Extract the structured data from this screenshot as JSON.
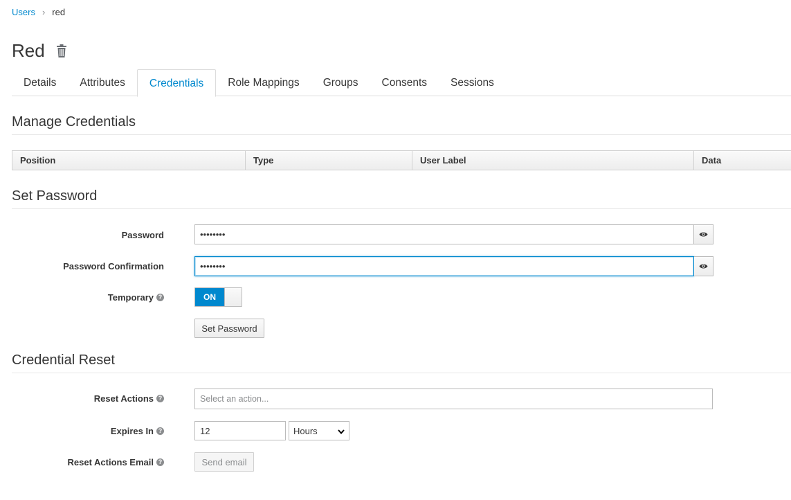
{
  "breadcrumb": {
    "parent": "Users",
    "separator": "›",
    "current": "red"
  },
  "page": {
    "title": "Red"
  },
  "tabs": [
    {
      "label": "Details"
    },
    {
      "label": "Attributes"
    },
    {
      "label": "Credentials",
      "active": true
    },
    {
      "label": "Role Mappings"
    },
    {
      "label": "Groups"
    },
    {
      "label": "Consents"
    },
    {
      "label": "Sessions"
    }
  ],
  "manage": {
    "title": "Manage Credentials",
    "columns": [
      "Position",
      "Type",
      "User Label",
      "Data"
    ]
  },
  "set_password": {
    "title": "Set Password",
    "password_label": "Password",
    "password_value": "••••••••",
    "confirm_label": "Password Confirmation",
    "confirm_value": "••••••••",
    "temporary_label": "Temporary",
    "temporary_state": "ON",
    "submit_label": "Set Password"
  },
  "credential_reset": {
    "title": "Credential Reset",
    "reset_actions_label": "Reset Actions",
    "reset_actions_placeholder": "Select an action...",
    "expires_label": "Expires In",
    "expires_value": "12",
    "expires_unit": "Hours",
    "email_label": "Reset Actions Email",
    "email_button": "Send email"
  },
  "colors": {
    "accent": "#0088ce",
    "text": "#363636",
    "muted": "#8b8d8f"
  }
}
